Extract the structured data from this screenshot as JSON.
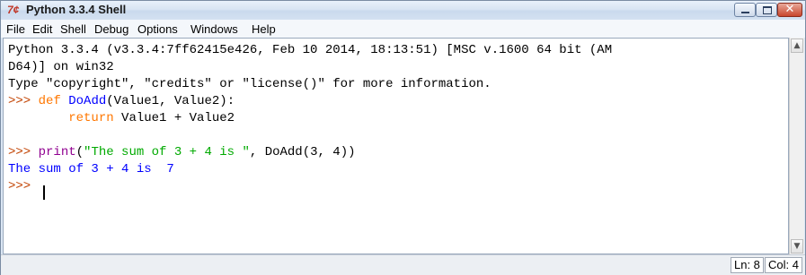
{
  "window": {
    "title": "Python 3.3.4 Shell",
    "icon": "python-idle-icon",
    "icon_text": "7¢"
  },
  "menu": {
    "items": [
      "File",
      "Edit",
      "Shell",
      "Debug",
      "Options",
      "Windows",
      "Help"
    ]
  },
  "shell": {
    "line1": "Python 3.3.4 (v3.3.4:7ff62415e426, Feb 10 2014, 18:13:51) [MSC v.1600 64 bit (AM",
    "line2": "D64)] on win32",
    "line3": "Type \"copyright\", \"credits\" or \"license()\" for more information.",
    "prompt": ">>>",
    "def_kw": "def",
    "def_name": "DoAdd",
    "def_params": "(Value1, Value2):",
    "return_kw": "return",
    "return_expr": " Value1 + Value2",
    "print_fn": "print",
    "print_open": "(",
    "print_str": "\"The sum of 3 + 4 is \"",
    "print_rest": ", DoAdd(3, 4))",
    "output": "The sum of 3 + 4 is  7"
  },
  "status": {
    "ln": "Ln: 8",
    "col": "Col: 4"
  },
  "colors": {
    "prompt": "#c24200",
    "keyword": "#ff7700",
    "definition": "#0000ff",
    "string": "#00aa00",
    "builtin": "#900090",
    "stdout": "#0000ff"
  }
}
